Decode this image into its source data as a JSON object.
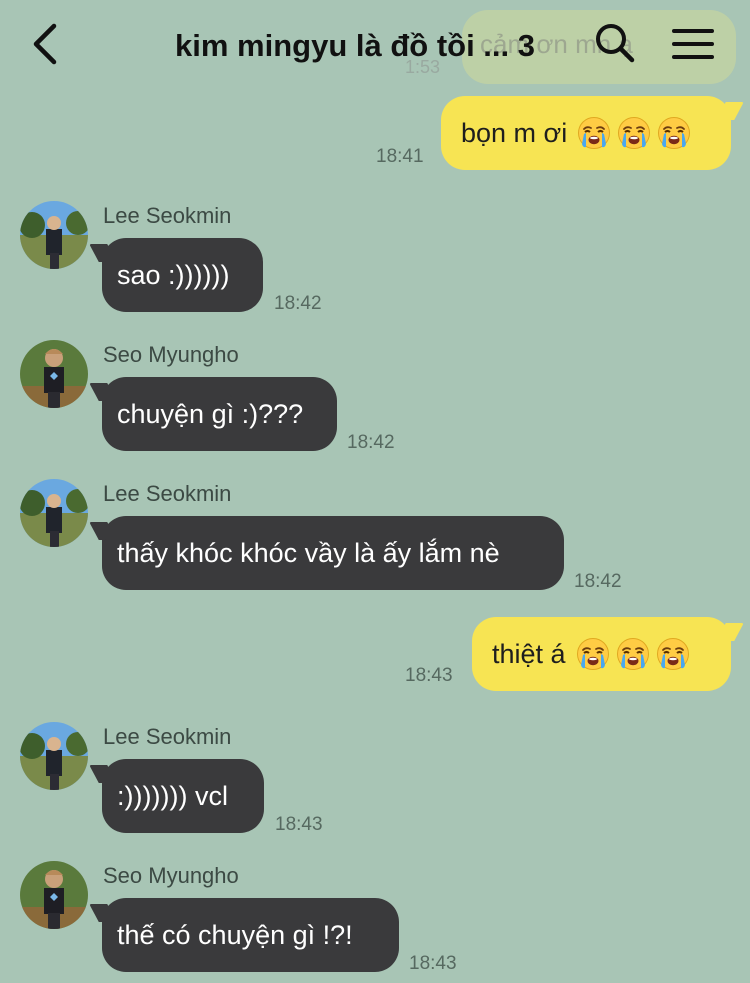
{
  "header": {
    "title": "kim mingyu là đồ tồi ... 3",
    "ghost_preview_text": "cảm ơn mn ạ",
    "ghost_preview_time": "1:53"
  },
  "messages": [
    {
      "type": "outgoing",
      "text": "bọn m ơi",
      "emoji": [
        "crying-face",
        "crying-face",
        "crying-face"
      ],
      "time": "18:41"
    },
    {
      "type": "incoming",
      "sender": "Lee Seokmin",
      "text": "sao :))))))",
      "time": "18:42"
    },
    {
      "type": "incoming",
      "sender": "Seo Myungho",
      "text": "chuyện gì :)???",
      "time": "18:42"
    },
    {
      "type": "incoming",
      "sender": "Lee Seokmin",
      "text": "thấy khóc khóc vầy là ấy lắm nè",
      "time": "18:42"
    },
    {
      "type": "outgoing",
      "text": "thiệt á",
      "emoji": [
        "crying-face",
        "crying-face",
        "crying-face"
      ],
      "time": "18:43"
    },
    {
      "type": "incoming",
      "sender": "Lee Seokmin",
      "text": ":))))))) vcl",
      "time": "18:43"
    },
    {
      "type": "incoming",
      "sender": "Seo Myungho",
      "text": "thế có chuyện gì !?!",
      "time": "18:43"
    }
  ],
  "colors": {
    "background": "#a8c5b5",
    "outgoing_bubble": "#f7e453",
    "incoming_bubble": "#3a3a3c",
    "timestamp": "#566960"
  }
}
